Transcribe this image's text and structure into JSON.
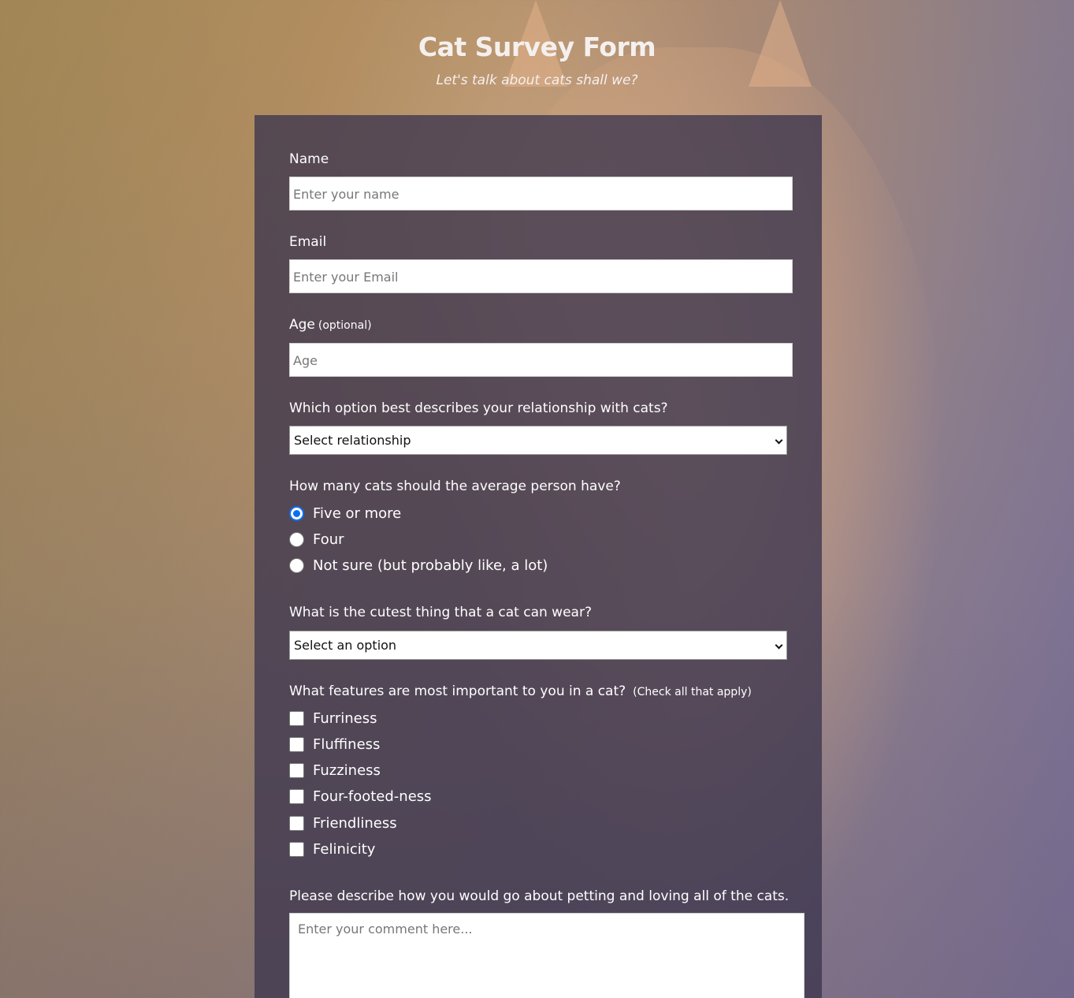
{
  "header": {
    "title": "Cat Survey Form",
    "subtitle": "Let's talk about cats shall we?"
  },
  "form": {
    "name": {
      "label": "Name",
      "placeholder": "Enter your name",
      "value": ""
    },
    "email": {
      "label": "Email",
      "placeholder": "Enter your Email",
      "value": ""
    },
    "age": {
      "label": "Age",
      "label_note": "(optional)",
      "placeholder": "Age",
      "value": ""
    },
    "relationship": {
      "label": "Which option best describes your relationship with cats?",
      "selected": "Select relationship"
    },
    "cat_count": {
      "label": "How many cats should the average person have?",
      "options": [
        {
          "label": "Five or more",
          "checked": true
        },
        {
          "label": "Four",
          "checked": false
        },
        {
          "label": "Not sure (but probably like, a lot)",
          "checked": false
        }
      ]
    },
    "cutest_wear": {
      "label": "What is the cutest thing that a cat can wear?",
      "selected": "Select an option"
    },
    "features": {
      "label": "What features are most important to you in a cat?",
      "label_note": "(Check all that apply)",
      "options": [
        {
          "label": "Furriness",
          "checked": false
        },
        {
          "label": "Fluffiness",
          "checked": false
        },
        {
          "label": "Fuzziness",
          "checked": false
        },
        {
          "label": "Four-footed-ness",
          "checked": false
        },
        {
          "label": "Friendliness",
          "checked": false
        },
        {
          "label": "Felinicity",
          "checked": false
        }
      ]
    },
    "comment": {
      "label": "Please describe how you would go about petting and loving all of the cats.",
      "placeholder": "Enter your comment here..."
    }
  },
  "colors": {
    "radio_accent": "#0b6ff2",
    "panel_bg": "#3c364e"
  }
}
